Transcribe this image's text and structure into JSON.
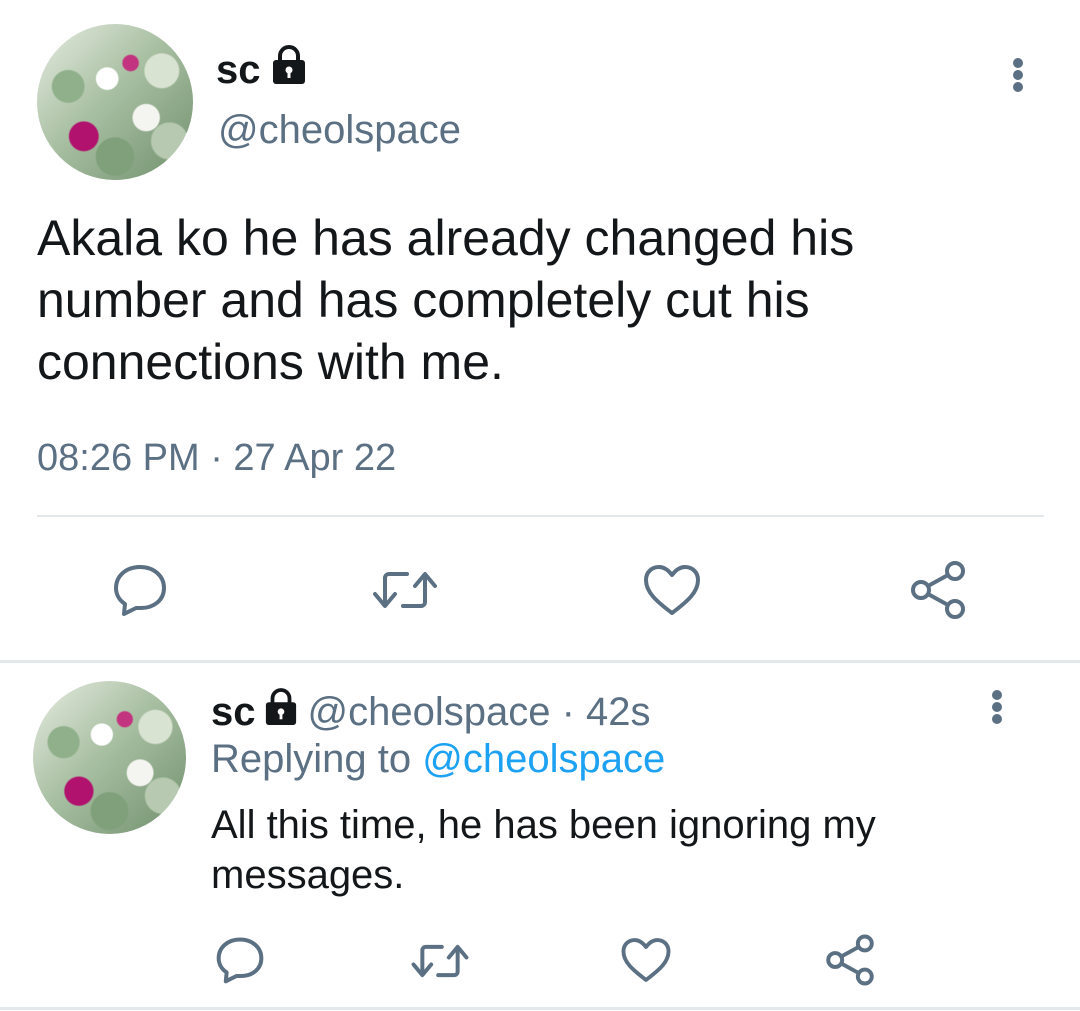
{
  "main_tweet": {
    "avatar_icon": "profile-avatar-flowers",
    "display_name": "sc",
    "handle": "@cheolspace",
    "protected_icon": "lock-icon",
    "text": "Akala ko he has already changed his number and has completely cut his connections with me.",
    "timestamp": "08:26 PM · 27 Apr 22",
    "more_icon": "more-vertical-icon",
    "actions": {
      "reply_icon": "reply-icon",
      "retweet_icon": "retweet-icon",
      "like_icon": "like-heart-icon",
      "share_icon": "share-icon"
    }
  },
  "reply_tweet": {
    "avatar_icon": "profile-avatar-flowers",
    "display_name": "sc",
    "protected_icon": "lock-icon",
    "handle_meta": "@cheolspace · 42s",
    "replying_to_label": "Replying to",
    "replying_to_handle": "@cheolspace",
    "text": "All this time, he has been ignoring my messages.",
    "more_icon": "more-vertical-icon",
    "actions": {
      "reply_icon": "reply-icon",
      "retweet_icon": "retweet-icon",
      "like_icon": "like-heart-icon",
      "share_icon": "share-icon"
    }
  },
  "colors": {
    "text_primary": "#14171a",
    "text_secondary": "#5b7083",
    "link": "#1da1f2",
    "divider": "#e3e8ec"
  }
}
